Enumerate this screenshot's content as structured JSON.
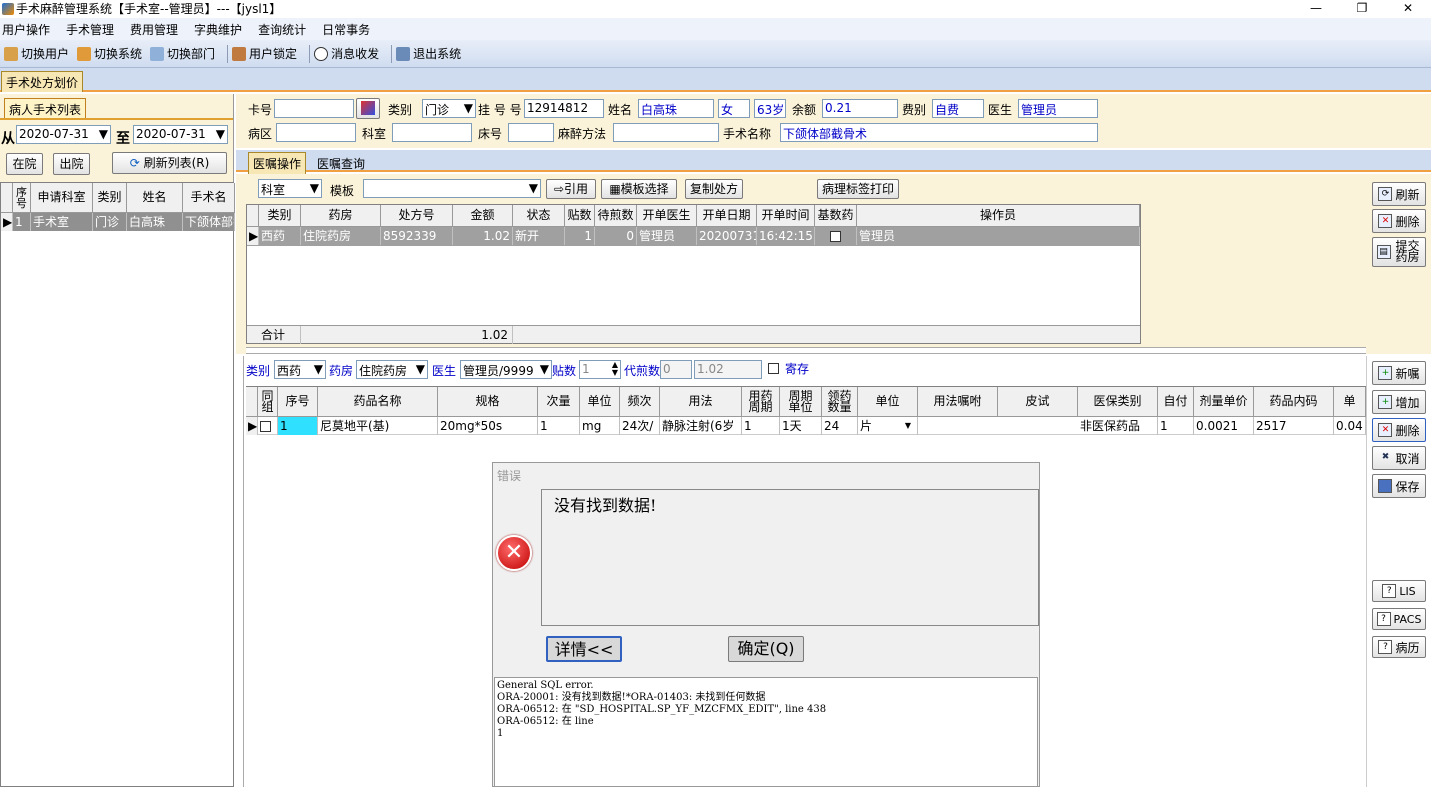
{
  "window": {
    "title": "手术麻醉管理系统【手术室--管理员】---【jysl1】",
    "min": "—",
    "max": "❐",
    "close": "✕"
  },
  "menu": [
    "用户操作",
    "手术管理",
    "费用管理",
    "字典维护",
    "查询统计",
    "日常事务"
  ],
  "toolbar": [
    {
      "label": "切换用户",
      "icon": "switch-user-icon"
    },
    {
      "label": "切换系统",
      "icon": "switch-system-icon"
    },
    {
      "label": "切换部门",
      "icon": "switch-department-icon"
    },
    {
      "label": "用户锁定",
      "icon": "lock-user-icon"
    },
    {
      "label": "消息收发",
      "icon": "message-icon"
    },
    {
      "label": "退出系统",
      "icon": "exit-icon"
    }
  ],
  "top_tab": "手术处方划价",
  "left": {
    "tab": "病人手术列表",
    "from_label": "从",
    "from_date": "2020-07-31",
    "to_label": "至",
    "to_date": "2020-07-31",
    "inhosp_btn": "在院",
    "discharge_btn": "出院",
    "refresh_btn": "刷新列表(R)",
    "columns": [
      "序号",
      "申请科室",
      "类别",
      "姓名",
      "手术名"
    ],
    "rows": [
      [
        "1",
        "手术室",
        "门诊",
        "白高珠",
        "下颌体部截"
      ]
    ]
  },
  "patient": {
    "card_label": "卡号",
    "card_no": "",
    "type_label": "类别",
    "type_val": "门诊",
    "reg_label": "挂 号 号",
    "reg_no": "12914812",
    "name_label": "姓名",
    "name": "白高珠",
    "sex": "女",
    "age": "63岁",
    "balance_label": "余额",
    "balance": "0.21",
    "fee_label": "费别",
    "fee": "自费",
    "doctor_label": "医生",
    "doctor": "管理员",
    "ward_label": "病区",
    "ward": "",
    "dept_label": "科室",
    "dept": "",
    "bed_label": "床号",
    "bed": "",
    "anes_label": "麻醉方法",
    "anes": "",
    "op_label": "手术名称",
    "op_name": "下颌体部截骨术"
  },
  "order_tabs": [
    "医嘱操作",
    "医嘱查询"
  ],
  "order_toolbar": {
    "dept": "科室",
    "template_label": "模板",
    "quote_btn": "引用",
    "template_btn": "模板选择",
    "copy_btn": "复制处方",
    "patho_btn": "病理标签打印"
  },
  "rx_grid": {
    "columns": [
      "类别",
      "药房",
      "处方号",
      "金额",
      "状态",
      "贴数",
      "待煎数",
      "开单医生",
      "开单日期",
      "开单时间",
      "基数药",
      "操作员"
    ],
    "rows": [
      [
        "西药",
        "住院药房",
        "8592339",
        "1.02",
        "新开",
        "1",
        "0",
        "管理员",
        "20200731",
        "16:42:15",
        "",
        "管理员"
      ]
    ],
    "total_label": "合计",
    "total": "1.02"
  },
  "right_top_btns": [
    {
      "label": "刷新",
      "icon": "refresh-icon"
    },
    {
      "label": "删除",
      "icon": "delete-icon"
    },
    {
      "label": "提交药房",
      "icon": "submit-pharmacy-icon"
    }
  ],
  "drug_toolbar": {
    "type_label": "类别",
    "type": "西药",
    "pharm_label": "药房",
    "pharm": "住院药房",
    "doctor_label": "医生",
    "doctor": "管理员/9999",
    "tie_label": "贴数",
    "tie": "1",
    "decoct_label": "代煎数",
    "decoct": "0",
    "amount": "1.02",
    "deposit_label": "寄存"
  },
  "drug_grid": {
    "columns": [
      "同组",
      "序号",
      "药品名称",
      "规格",
      "次量",
      "单位",
      "频次",
      "用法",
      "用药周期",
      "周期单位",
      "领药数量",
      "单位",
      "用法嘱咐",
      "皮试",
      "医保类别",
      "自付",
      "剂量单价",
      "药品内码",
      "单"
    ],
    "rows": [
      [
        "",
        "1",
        "尼莫地平(基)",
        "20mg*50s",
        "1",
        "mg",
        "24次/",
        "静脉注射(6岁",
        "1",
        "1天",
        "24",
        "片",
        "",
        "",
        "非医保药品",
        "1",
        "0.0021",
        "2517",
        "0.04"
      ]
    ]
  },
  "right_bottom_btns": [
    {
      "label": "新嘱",
      "icon": "new-order-icon"
    },
    {
      "label": "增加",
      "icon": "add-icon"
    },
    {
      "label": "删除",
      "icon": "delete-icon"
    },
    {
      "label": "取消",
      "icon": "cancel-icon"
    },
    {
      "label": "保存",
      "icon": "save-icon"
    }
  ],
  "right_extra_btns": [
    "LIS",
    "PACS",
    "病历"
  ],
  "dialog": {
    "title": "错误",
    "message": "没有找到数据!",
    "details_btn": "详情<<",
    "ok_btn": "确定(Q)",
    "details": [
      "General SQL error.",
      "ORA-20001: 没有找到数据!*ORA-01403: 未找到任何数据",
      "ORA-06512: 在 \"SD_HOSPITAL.SP_YF_MZCFMX_EDIT\", line 438",
      "ORA-06512: 在 line",
      "1"
    ]
  }
}
